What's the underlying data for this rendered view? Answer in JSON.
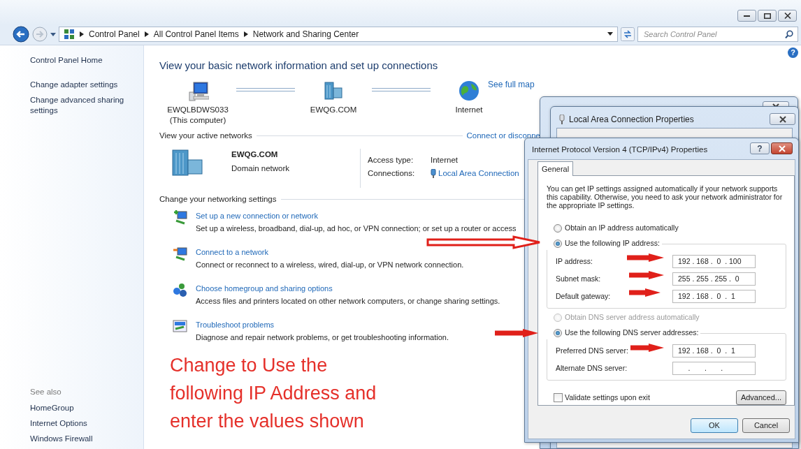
{
  "address_bar": {
    "breadcrumbs": [
      "Control Panel",
      "All Control Panel Items",
      "Network and Sharing Center"
    ],
    "search": {
      "placeholder": "Search Control Panel"
    }
  },
  "help_glyph": "?",
  "sidebar": {
    "items": [
      "Control Panel Home",
      "Change adapter settings",
      "Change advanced sharing settings"
    ],
    "see_also_heading": "See also",
    "see_also": [
      "HomeGroup",
      "Internet Options",
      "Windows Firewall"
    ]
  },
  "main": {
    "title": "View your basic network information and set up connections",
    "see_full_map": "See full map",
    "map_nodes": [
      {
        "kind": "computer",
        "name": "EWQLBDWS033",
        "subtitle": "(This computer)"
      },
      {
        "kind": "domain",
        "name": "EWQG.COM"
      },
      {
        "kind": "internet",
        "name": "Internet"
      }
    ],
    "active_networks": {
      "heading": "View your active networks",
      "connect_link": "Connect or disconne",
      "network_name": "EWQG.COM",
      "network_type": "Domain network",
      "access_type_label": "Access type:",
      "access_type": "Internet",
      "connections_label": "Connections:",
      "connection": "Local Area Connection"
    },
    "settings": {
      "heading": "Change your networking settings",
      "tasks": [
        {
          "kind": "new-connection",
          "title": "Set up a new connection or network",
          "description": "Set up a wireless, broadband, dial-up, ad hoc, or VPN connection; or set up a router or access"
        },
        {
          "kind": "connect",
          "title": "Connect to a network",
          "description": "Connect or reconnect to a wireless, wired, dial-up, or VPN network connection."
        },
        {
          "kind": "homegroup",
          "title": "Choose homegroup and sharing options",
          "description": "Access files and printers located on other network computers, or change sharing settings."
        },
        {
          "kind": "troubleshoot",
          "title": "Troubleshoot problems",
          "description": "Diagnose and repair network problems, or get troubleshooting information."
        }
      ]
    }
  },
  "annotation": {
    "text": "Change to Use the following IP Address and enter the values shown"
  },
  "properties_dialog": {
    "title": "Local Area Connection Properties"
  },
  "ipv4_dialog": {
    "title": "Internet Protocol Version 4 (TCP/IPv4) Properties",
    "help_glyph": "?",
    "tabs": [
      {
        "label": "General",
        "selected": true
      }
    ],
    "intro": "You can get IP settings assigned automatically if your network supports this capability. Otherwise, you need to ask your network administrator for the appropriate IP settings.",
    "ip_options": [
      {
        "label": "Obtain an IP address automatically",
        "selected": false,
        "disabled": false
      },
      {
        "label": "Use the following IP address:",
        "selected": true,
        "disabled": false
      }
    ],
    "ip_fields": [
      {
        "label": "IP address:",
        "value": "192 . 168 .  0  . 100"
      },
      {
        "label": "Subnet mask:",
        "value": "255 . 255 . 255 .  0"
      },
      {
        "label": "Default gateway:",
        "value": "192 . 168 .  0  .  1"
      }
    ],
    "dns_options": [
      {
        "label": "Obtain DNS server address automatically",
        "selected": false,
        "disabled": true
      },
      {
        "label": "Use the following DNS server addresses:",
        "selected": true,
        "disabled": false
      }
    ],
    "dns_fields": [
      {
        "label": "Preferred DNS server:",
        "value": "192 . 168 .  0  .  1"
      },
      {
        "label": "Alternate DNS server:",
        "value": "     .       .       .     "
      }
    ],
    "validate": {
      "label": "Validate settings upon exit",
      "checked": false
    },
    "advanced_button": "Advanced...",
    "buttons": [
      {
        "label": "OK",
        "default": true
      },
      {
        "label": "Cancel",
        "default": false
      }
    ]
  }
}
